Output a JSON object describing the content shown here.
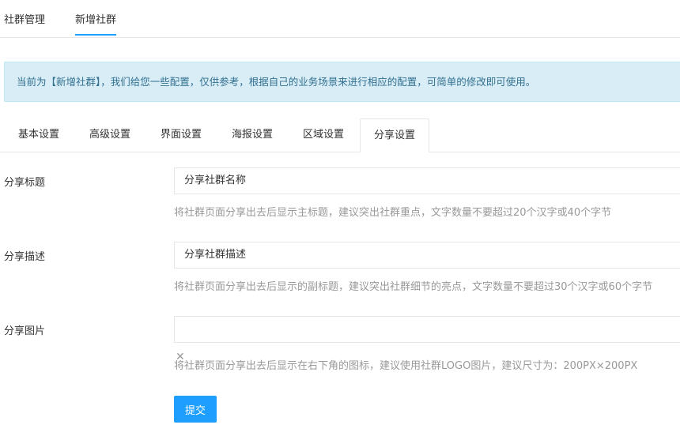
{
  "top_tabs": [
    {
      "label": "社群管理",
      "active": false
    },
    {
      "label": "新增社群",
      "active": true
    }
  ],
  "notice": {
    "text": "当前为【新增社群】，我们给您一些配置，仅供参考，根据自己的业务场景来进行相应的配置，可简单的修改即可使用。"
  },
  "sub_tabs": [
    {
      "label": "基本设置"
    },
    {
      "label": "高级设置"
    },
    {
      "label": "界面设置"
    },
    {
      "label": "海报设置"
    },
    {
      "label": "区域设置"
    },
    {
      "label": "分享设置",
      "active": true
    }
  ],
  "form": {
    "share_title": {
      "label": "分享标题",
      "value": "分享社群名称",
      "hint": "将社群页面分享出去后显示主标题，建议突出社群重点，文字数量不要超过20个汉字或40个字节"
    },
    "share_desc": {
      "label": "分享描述",
      "value": "分享社群描述",
      "hint": "将社群页面分享出去后显示的副标题，建议突出社群细节的亮点，文字数量不要超过30个汉字或60个字节"
    },
    "share_image": {
      "label": "分享图片",
      "value": "",
      "hint": "将社群页面分享出去后显示在右下角的图标，建议使用社群LOGO图片，建议尺寸为：200PX×200PX"
    },
    "submit_label": "提交"
  },
  "colors": {
    "accent": "#1e9fff",
    "notice_bg": "#d9edf7",
    "notice_text": "#31708f",
    "hint_text": "#999999"
  }
}
